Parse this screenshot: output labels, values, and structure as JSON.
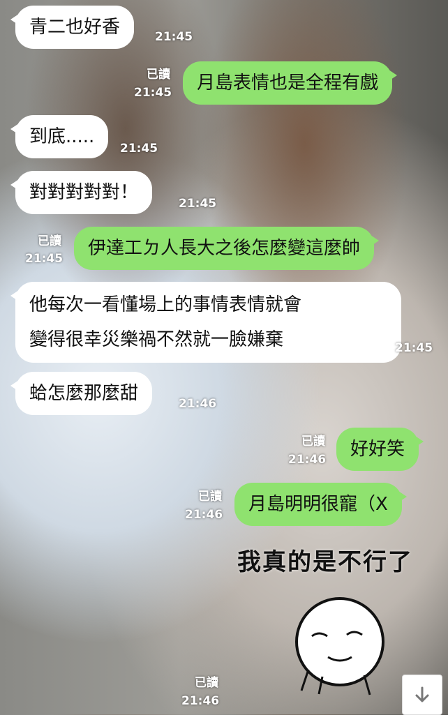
{
  "chat": {
    "messages": [
      {
        "side": "in",
        "text": "青二也好香",
        "time": "21:45"
      },
      {
        "side": "out",
        "text": "月島表情也是全程有戲",
        "read": "已讀",
        "time": "21:45"
      },
      {
        "side": "in",
        "text": "到底.....",
        "time": "21:45"
      },
      {
        "side": "in",
        "text": "對對對對對！",
        "time": "21:45"
      },
      {
        "side": "out",
        "text": "伊達工ㄉ人長大之後怎麼變這麼帥",
        "read": "已讀",
        "time": "21:45"
      },
      {
        "side": "in",
        "line1": "他每次一看懂場上的事情表情就會",
        "line2": "變得很幸災樂禍不然就一臉嫌棄",
        "time": "21:45"
      },
      {
        "side": "in",
        "text": "蛤怎麼那麼甜",
        "time": "21:46"
      },
      {
        "side": "out",
        "text": "好好笑",
        "read": "已讀",
        "time": "21:46"
      },
      {
        "side": "out",
        "text": "月島明明很寵（X",
        "read": "已讀",
        "time": "21:46"
      }
    ],
    "sticker": {
      "text": "我真的是不行了",
      "read": "已讀",
      "time": "21:46"
    }
  },
  "colors": {
    "outgoing": "#8fe26f",
    "incoming": "#ffffff"
  },
  "icons": {
    "scroll": "arrow-down-icon"
  }
}
